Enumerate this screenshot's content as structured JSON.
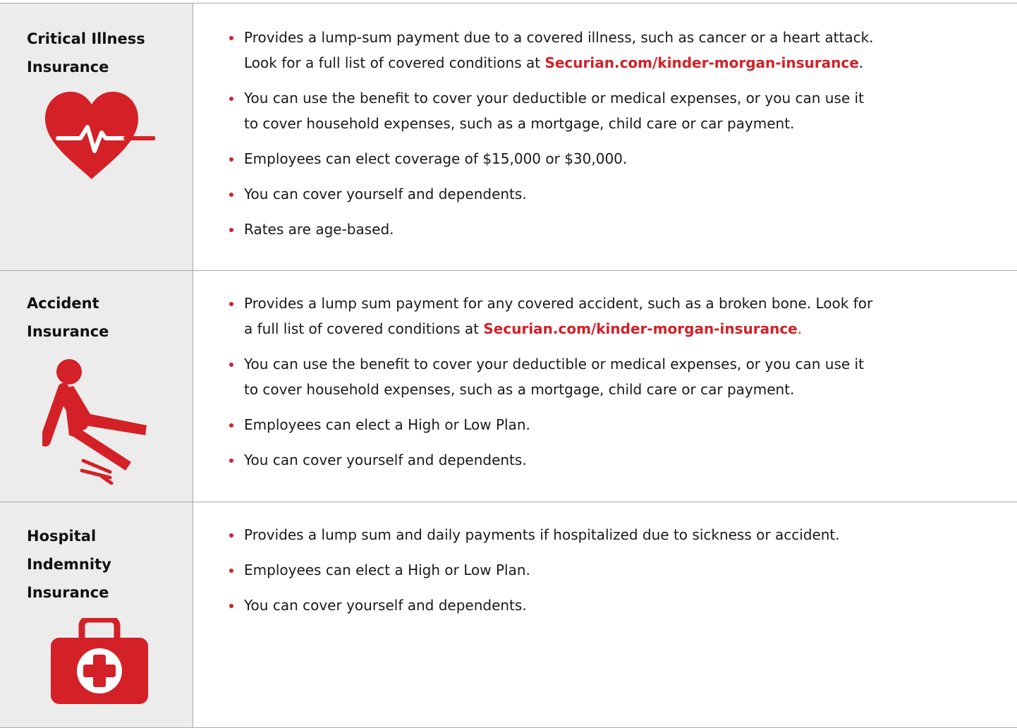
{
  "colors": {
    "accent": "#d42027",
    "panel": "#ececec",
    "rule": "#a9a9b4"
  },
  "rows": [
    {
      "title_lines": [
        "Critical Illness",
        "Insurance"
      ],
      "icon": "heartbeat-icon",
      "bullets": [
        {
          "lines": [
            "Provides a lump-sum payment due to a covered illness, such as cancer or a heart attack.",
            "Look for a full list of covered conditions at "
          ],
          "link": "Securian.com/kinder-morgan-insurance",
          "after": "."
        },
        {
          "lines": [
            "You can use the benefit to cover your deductible or medical expenses, or you can use it",
            "to cover household expenses, such as a mortgage, child care or car payment."
          ]
        },
        {
          "lines": [
            "Employees can elect coverage of $15,000 or $30,000."
          ]
        },
        {
          "lines": [
            "You can cover yourself and dependents."
          ]
        },
        {
          "lines": [
            "Rates are age-based."
          ]
        }
      ]
    },
    {
      "title_lines": [
        "Accident",
        "Insurance"
      ],
      "icon": "slip-and-fall-icon",
      "bullets": [
        {
          "lines": [
            "Provides a lump sum payment for any covered accident, such as a broken bone. Look for",
            "a full list of covered conditions at "
          ],
          "link": "Securian.com/kinder-morgan-insurance",
          "after": "."
        },
        {
          "lines": [
            "You can use the benefit to cover your deductible or medical expenses, or you can use it",
            "to cover household expenses, such as a mortgage, child care or car payment."
          ]
        },
        {
          "lines": [
            "Employees can elect a High or Low Plan."
          ]
        },
        {
          "lines": [
            "You can cover yourself and dependents."
          ]
        }
      ]
    },
    {
      "title_lines": [
        "Hospital",
        "Indemnity",
        "Insurance"
      ],
      "icon": "first-aid-kit-icon",
      "bullets": [
        {
          "lines": [
            "Provides a lump sum and daily payments if hospitalized due to sickness or accident."
          ]
        },
        {
          "lines": [
            "Employees can elect a High or Low Plan."
          ]
        },
        {
          "lines": [
            "You can cover yourself and dependents."
          ]
        }
      ]
    }
  ]
}
